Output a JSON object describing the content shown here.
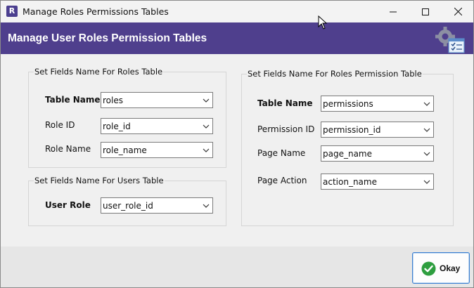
{
  "window": {
    "app_icon_letter": "R",
    "title": "Manage Roles Permissions Tables",
    "minimize_icon": "minimize-icon",
    "maximize_icon": "maximize-icon",
    "close_icon": "close-icon"
  },
  "header": {
    "title": "Manage User Roles Permission Tables",
    "icon": "settings-checklist-icon",
    "background": "#4f3f8d"
  },
  "roles_group": {
    "title": "Set Fields Name For Roles Table",
    "table_name": {
      "label": "Table Name",
      "value": "roles"
    },
    "role_id": {
      "label": "Role ID",
      "value": "role_id"
    },
    "role_name": {
      "label": "Role Name",
      "value": "role_name"
    }
  },
  "users_group": {
    "title": "Set Fields Name For Users Table",
    "user_role": {
      "label": "User Role",
      "value": "user_role_id"
    }
  },
  "permission_group": {
    "title": "Set Fields Name For Roles Permission Table",
    "table_name": {
      "label": "Table Name",
      "value": "permissions"
    },
    "permission_id": {
      "label": "Permission ID",
      "value": "permission_id"
    },
    "page_name": {
      "label": "Page Name",
      "value": "page_name"
    },
    "page_action": {
      "label": "Page Action",
      "value": "action_name"
    }
  },
  "footer": {
    "okay_label": "Okay",
    "okay_icon": "check-circle-icon",
    "accent": "#3c7fd0"
  }
}
